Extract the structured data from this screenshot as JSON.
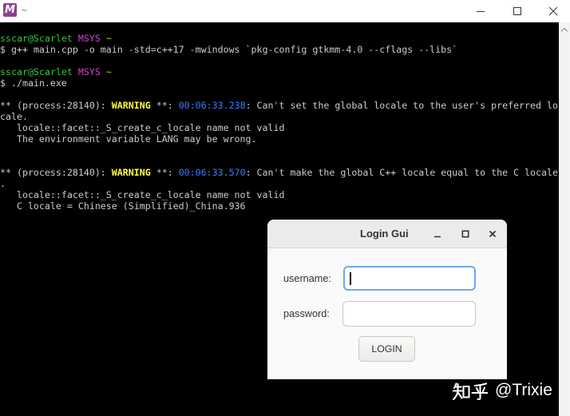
{
  "window": {
    "title": "~",
    "app_icon": "msys2-icon",
    "app_icon_letter": "M",
    "controls": {
      "minimize": "minimize-icon",
      "maximize": "maximize-icon",
      "close": "close-icon"
    }
  },
  "terminal": {
    "prompt_1": {
      "user_host": "sscar@Scarlet",
      "env": "MSYS",
      "cwd": "~"
    },
    "command_1": "$ g++ main.cpp -o main -std=c++17 -mwindows `pkg-config gtkmm-4.0 --cflags --libs`",
    "prompt_2": {
      "user_host": "sscar@Scarlet",
      "env": "MSYS",
      "cwd": "~"
    },
    "command_2": "$ ./main.exe",
    "warning_1": {
      "prefix": "** (process:28140): ",
      "level": "WARNING",
      "sep": " **: ",
      "time": "00:06:33.238",
      "message": ": Can't set the global locale to the user's preferred lo",
      "message_wrap": "cale.",
      "details": [
        "   locale::facet::_S_create_c_locale name not valid",
        "   The environment variable LANG may be wrong."
      ]
    },
    "warning_2": {
      "prefix": "** (process:28140): ",
      "level": "WARNING",
      "sep": " **: ",
      "time": "00:06:33.570",
      "message": ": Can't make the global C++ locale equal to the C locale",
      "message_wrap": ".",
      "details": [
        "   locale::facet::_S_create_c_locale name not valid",
        "   C locale = Chinese (Simplified)_China.936"
      ]
    },
    "scroll_up_icon": "chevron-up-icon"
  },
  "dialog": {
    "title": "Login Gui",
    "controls": {
      "minimize": "minimize-icon",
      "maximize": "maximize-icon",
      "close": "close-icon"
    },
    "username_label": "username:",
    "username_value": "",
    "password_label": "password:",
    "password_value": "",
    "login_label": "LOGIN"
  },
  "watermark": {
    "brand": "知乎",
    "handle": "@Trixie"
  },
  "colors": {
    "terminal_bg": "#000000",
    "terminal_fg": "#cccccc",
    "prompt_user_host": "#3ec13e",
    "prompt_env": "#c846c8",
    "prompt_cwd": "#c6c02a",
    "warning": "#ffff44",
    "timestamp": "#3a7bff",
    "app_icon": "#8e3f93",
    "focus_ring": "#6ea7ec"
  }
}
